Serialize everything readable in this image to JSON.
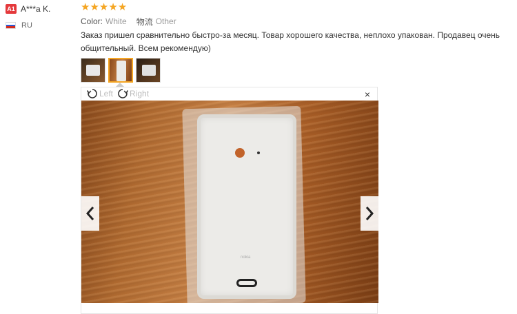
{
  "user": {
    "badge": "A1",
    "name": "A***a K.",
    "country": "RU"
  },
  "review": {
    "rating": 5,
    "attributes": [
      {
        "label": "Color:",
        "value": "White"
      },
      {
        "label": "物流",
        "value": "Other"
      }
    ],
    "text": "Заказ пришел сравнительно быстро-за месяц. Товар хорошего качества, неплохо упакован. Продавец очень общительный. Всем рекомендую)"
  },
  "thumbnails": {
    "count": 3,
    "active_index": 1
  },
  "viewer": {
    "rotate_left_label": "Left",
    "rotate_right_label": "Right",
    "close_label": "×",
    "phone_logo": "nokia"
  },
  "colors": {
    "star": "#f5a623",
    "badge": "#e4393c",
    "active_border": "#f5a623"
  },
  "icons": [
    "star-icon",
    "flag-icon",
    "rotate-left-icon",
    "rotate-right-icon",
    "close-icon",
    "chevron-left-icon",
    "chevron-right-icon"
  ]
}
